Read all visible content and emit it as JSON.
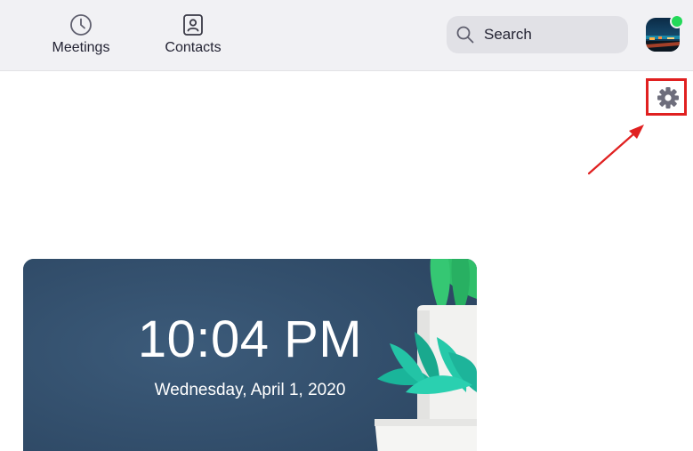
{
  "toolbar": {
    "tabs": [
      {
        "label": "Meetings",
        "icon": "clock-icon"
      },
      {
        "label": "Contacts",
        "icon": "contact-card-icon"
      }
    ],
    "search": {
      "label": "Search",
      "icon": "search-icon"
    },
    "avatar": {
      "status": "online",
      "status_color": "#23d959"
    }
  },
  "settings": {
    "icon": "gear-icon"
  },
  "annotation": {
    "color": "#e02020"
  },
  "clock_card": {
    "time": "10:04 PM",
    "date": "Wednesday, April 1, 2020"
  },
  "colors": {
    "toolbar_bg": "#f1f1f4",
    "card_bg": "#33506e",
    "accent_green": "#23d959"
  }
}
